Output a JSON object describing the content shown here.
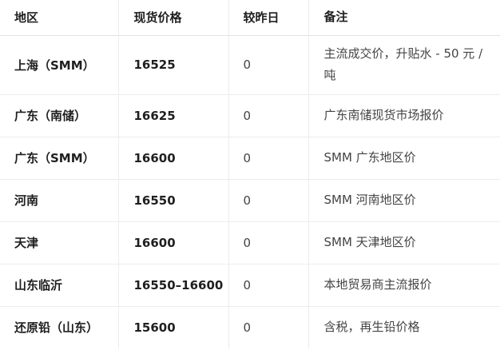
{
  "table": {
    "headers": [
      "地区",
      "现货价格",
      "较昨日",
      "备注"
    ],
    "rows": [
      {
        "region": "上海（SMM）",
        "price": "16525",
        "change": "0",
        "note": "主流成交价，升贴水 - 50 元 / 吨"
      },
      {
        "region": "广东（南储）",
        "price": "16625",
        "change": "0",
        "note": "广东南储现货市场报价"
      },
      {
        "region": "广东（SMM）",
        "price": "16600",
        "change": "0",
        "note": "SMM 广东地区价"
      },
      {
        "region": "河南",
        "price": "16550",
        "change": "0",
        "note": "SMM 河南地区价"
      },
      {
        "region": "天津",
        "price": "16600",
        "change": "0",
        "note": "SMM 天津地区价"
      },
      {
        "region": "山东临沂",
        "price": "16550–16600",
        "change": "0",
        "note": "本地贸易商主流报价"
      },
      {
        "region": "还原铅（山东）",
        "price": "15600",
        "change": "0",
        "note": "含税，再生铅价格"
      }
    ]
  }
}
